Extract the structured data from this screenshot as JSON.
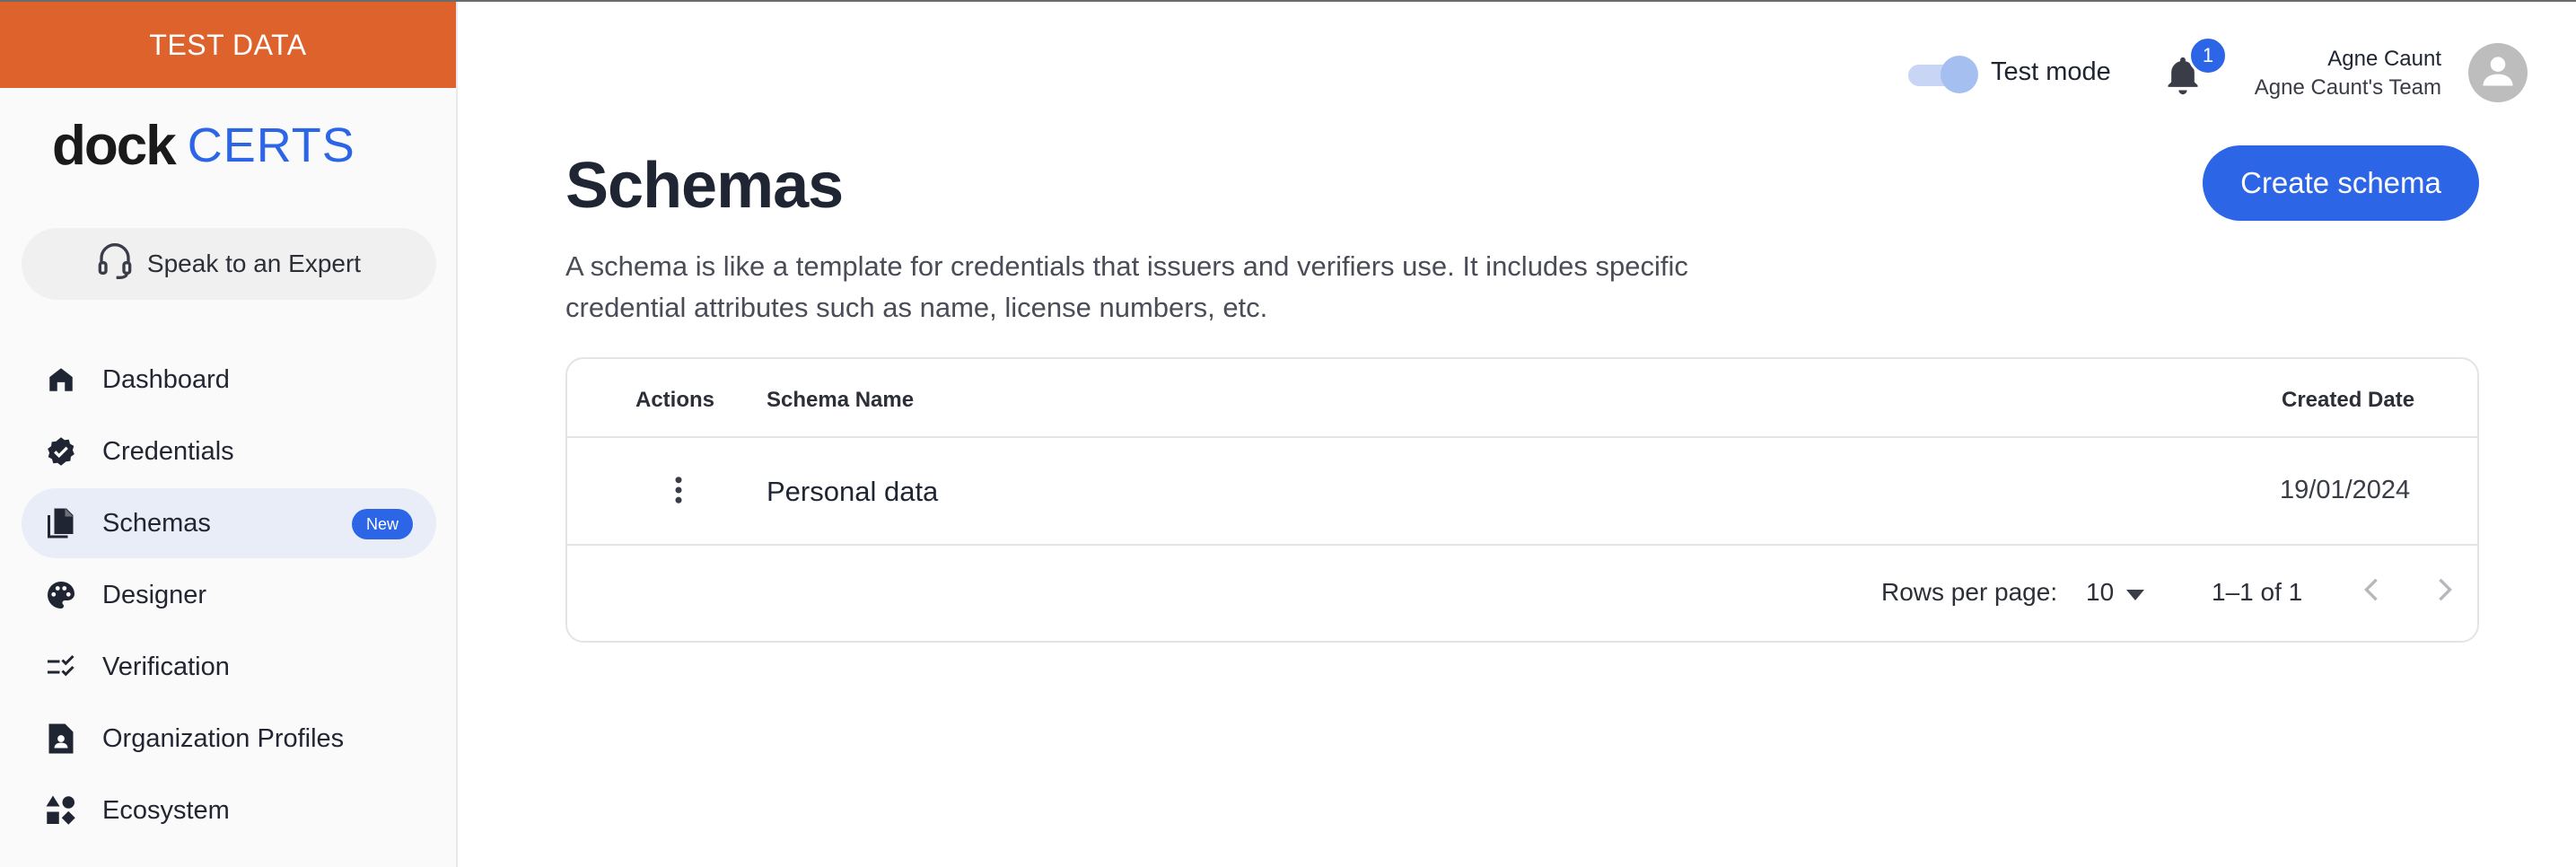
{
  "banner": {
    "text": "TEST DATA",
    "color": "#dd622c"
  },
  "logo": {
    "part1": "dock",
    "part2": "CERTS"
  },
  "expert_button": {
    "label": "Speak to an Expert",
    "icon": "headset-icon"
  },
  "nav": {
    "items": [
      {
        "label": "Dashboard",
        "icon": "home-icon"
      },
      {
        "label": "Credentials",
        "icon": "verified-badge-icon"
      },
      {
        "label": "Schemas",
        "icon": "documents-icon",
        "active": true,
        "badge": "New"
      },
      {
        "label": "Designer",
        "icon": "palette-icon"
      },
      {
        "label": "Verification",
        "icon": "checklist-icon"
      },
      {
        "label": "Organization Profiles",
        "icon": "person-document-icon"
      },
      {
        "label": "Ecosystem",
        "icon": "shapes-icon"
      }
    ]
  },
  "header": {
    "test_mode_label": "Test mode",
    "test_mode_on": true,
    "notifications_count": "1",
    "user_name": "Agne Caunt",
    "user_team": "Agne Caunt's Team"
  },
  "main": {
    "title": "Schemas",
    "create_button": "Create schema",
    "description": "A schema is like a template for credentials that issuers and verifiers use. It includes specific credential attributes such as name, license numbers, etc.",
    "table": {
      "columns": {
        "actions": "Actions",
        "name": "Schema Name",
        "created": "Created Date"
      },
      "rows": [
        {
          "name": "Personal data",
          "created": "19/01/2024"
        }
      ],
      "pagination": {
        "rows_per_page_label": "Rows per page:",
        "rows_per_page": "10",
        "range": "1–1 of 1"
      }
    }
  },
  "colors": {
    "accent": "#2c66e6",
    "banner": "#dd622c",
    "active_nav": "#e9edf8"
  }
}
